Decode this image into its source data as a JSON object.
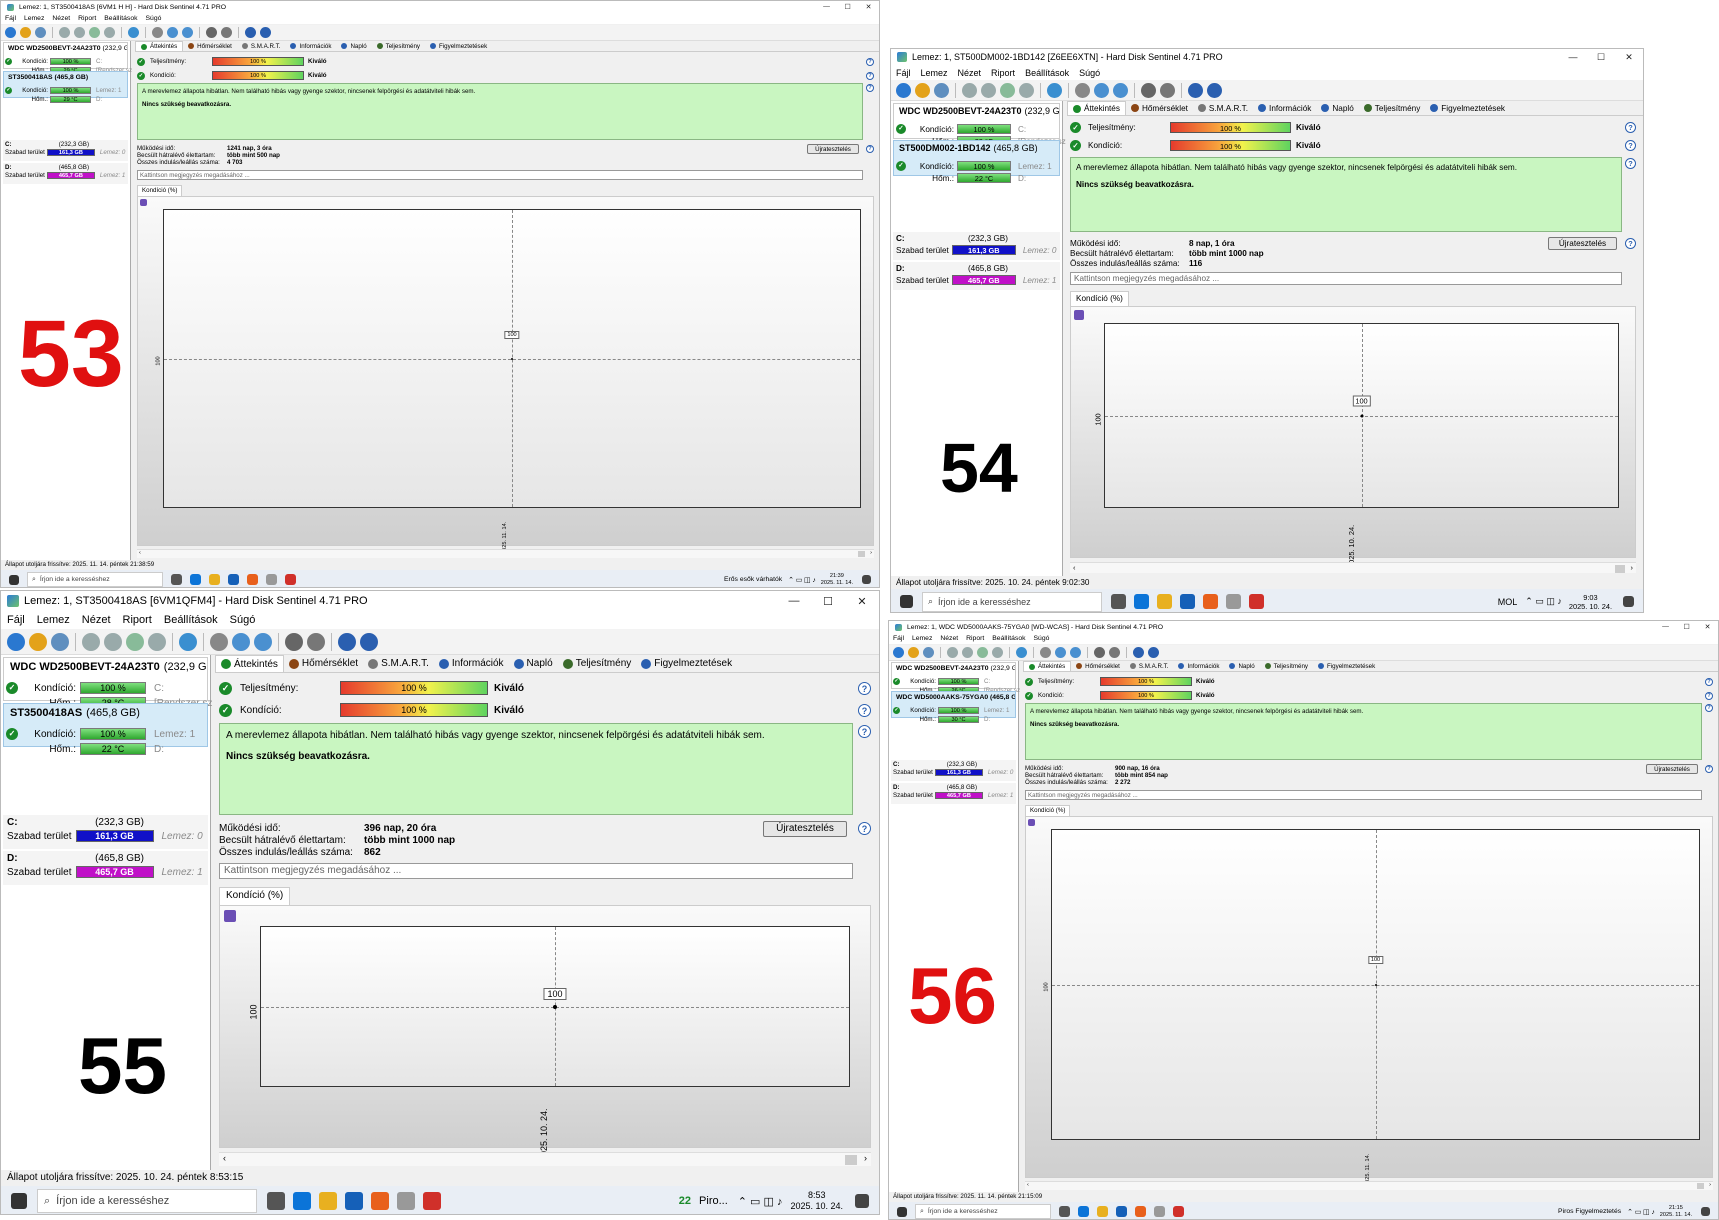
{
  "app": {
    "disk1_name": "WDC WD2500BEVT-24A23T0",
    "disk1_size": "(232,9 GB)",
    "menus": [
      "Fájl",
      "Lemez",
      "Nézet",
      "Riport",
      "Beállítások",
      "Súgó"
    ],
    "tabs": [
      "Áttekintés",
      "Hőmérséklet",
      "S.M.A.R.T.",
      "Információk",
      "Napló",
      "Teljesítmény",
      "Figyelmeztetések"
    ],
    "perf_label": "Teljesítmény:",
    "cond_label": "Kondíció:",
    "kivalo": "Kiváló",
    "kondicio": "Kondíció:",
    "hom": "Hőm.:",
    "szabad": "Szabad terület",
    "vol_c": "C:",
    "vol_c_size": "(232,3 GB)",
    "vol_c_free": "161,3 GB",
    "vol_d": "D:",
    "vol_d_size": "(465,8 GB)",
    "vol_d_free": "465,7 GB",
    "lemez0": "Lemez: 0",
    "lemez1": "Lemez: 1",
    "rendszer": "[Rendszer sz",
    "c_drive": "C:",
    "d_drive": "D:",
    "green_main": "A merevlemez állapota hibátlan. Nem található hibás vagy gyenge szektor, nincsenek felpörgési és adatátviteli hibák sem.",
    "green_sub": "Nincs szükség beavatkozásra.",
    "mukodesi": "Működési idő:",
    "becsult": "Becsült hátralévő élettartam:",
    "osszes": "Összes indulás/leállás száma:",
    "ujra": "Újratesztelés",
    "note": "Kattintson megjegyzés megadásához ...",
    "chart_tab": "Kondíció  (%)",
    "help": "?",
    "search": "Írjon ide a keresséshez",
    "date": "2025. 10. 24."
  },
  "windows": [
    {
      "number": "53",
      "number_color": "#e01010",
      "title": "Lemez: 1, ST3500418AS [6VM1 H H] - Hard Disk Sentinel 4.71 PRO",
      "disk2_name": "ST3500418AS (465,8 GB)",
      "disk1_pct": "100 %",
      "disk1_temp": "29 °C",
      "disk2_pct": "100 %",
      "disk2_temp": "29 °C",
      "perf_pct": "100 %",
      "cond_pct": "100 %",
      "uptime": "1241 nap, 3 óra",
      "remaining": "több mint 500 nap",
      "starts": "4 703",
      "chart_value": "100",
      "chart_date": "2025. 11. 14.",
      "status": "Állapot utoljára frissítve: 2025. 11. 14. péntek 21:38:59",
      "tray_text": "Erős esők várhatók",
      "clock_time": "21:39",
      "clock_date": "2025. 11. 14."
    },
    {
      "number": "54",
      "number_color": "#000000",
      "title": "Lemez: 1, ST500DM002-1BD142 [Z6EE6XTN]  -  Hard Disk Sentinel 4.71 PRO",
      "disk2_name": "ST500DM002-1BD142",
      "disk2_size": "(465,8 GB)",
      "disk1_pct": "100 %",
      "disk1_temp": "29 °C",
      "disk2_pct": "100 %",
      "disk2_temp": "22 °C",
      "perf_pct": "100 %",
      "cond_pct": "100 %",
      "uptime": "8 nap, 1 óra",
      "remaining": "több mint 1000 nap",
      "starts": "116",
      "chart_value": "100",
      "chart_date": "2025. 10. 24.",
      "status": "Állapot utoljára frissítve: 2025. 10. 24. péntek 9:02:30",
      "tray_text": "MOL",
      "clock_time": "9:03",
      "clock_date": "2025. 10. 24."
    },
    {
      "number": "55",
      "number_color": "#000000",
      "title": "Lemez: 1, ST3500418AS [6VM1QFM4]  -  Hard Disk Sentinel 4.71 PRO",
      "disk2_name": "ST3500418AS",
      "disk2_size": "(465,8 GB)",
      "disk1_pct": "100 %",
      "disk1_temp": "28 °C",
      "disk2_pct": "100 %",
      "disk2_temp": "22 °C",
      "perf_pct": "100 %",
      "cond_pct": "100 %",
      "uptime": "396 nap, 20 óra",
      "remaining": "több mint 1000 nap",
      "starts": "862",
      "chart_value": "100",
      "chart_date": "2025. 10. 24.",
      "status": "Állapot utoljára frissítve: 2025. 10. 24. péntek 8:53:15",
      "tray_text": "Piro...",
      "tray_count": "22",
      "clock_time": "8:53",
      "clock_date": "2025. 10. 24."
    },
    {
      "number": "56",
      "number_color": "#e01010",
      "title": "Lemez: 1, WDC WD5000AAKS-75YGA0 [WD-WCAS] - Hard Disk Sentinel 4.71 PRO",
      "disk2_name": "WDC WD5000AAKS-75YGA0 (465,8 GB)",
      "disk1_pct": "100 %",
      "disk1_temp": "26 °C",
      "disk2_pct": "100 %",
      "disk2_temp": "30 °C",
      "perf_pct": "100 %",
      "cond_pct": "100 %",
      "uptime": "900 nap, 16 óra",
      "remaining": "több mint 854 nap",
      "starts": "2 272",
      "chart_value": "100",
      "chart_date": "2025. 11. 14.",
      "status": "Állapot utoljára frissítve: 2025. 11. 14. péntek 21:15:09",
      "tray_text": "Piros Figyelmeztetés",
      "clock_time": "21:15",
      "clock_date": "2025. 11. 14."
    }
  ]
}
